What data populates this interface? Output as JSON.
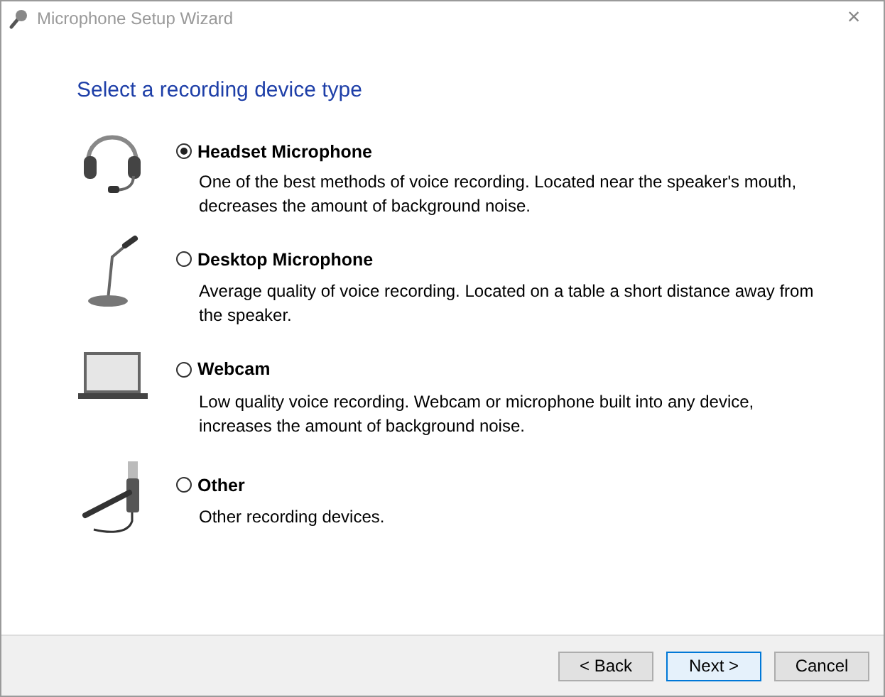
{
  "window": {
    "title": "Microphone Setup Wizard",
    "close": "×"
  },
  "heading": "Select a recording device type",
  "options": [
    {
      "kind": "headset",
      "label": "Headset Microphone",
      "selected": true,
      "description": "One of the best methods of voice recording. Located near the speaker's mouth, decreases the amount of background noise."
    },
    {
      "kind": "desktop",
      "label": "Desktop Microphone",
      "selected": false,
      "description": "Average quality of voice recording. Located on a table a short distance away from the speaker."
    },
    {
      "kind": "webcam",
      "label": "Webcam",
      "selected": false,
      "description": "Low quality voice recording. Webcam or microphone built into any device, increases the amount of background noise."
    },
    {
      "kind": "other",
      "label": "Other",
      "selected": false,
      "description": "Other recording devices."
    }
  ],
  "buttons": [
    {
      "label": "< Back",
      "focused": false
    },
    {
      "label": "Next >",
      "focused": true
    },
    {
      "label": "Cancel",
      "focused": false
    }
  ]
}
